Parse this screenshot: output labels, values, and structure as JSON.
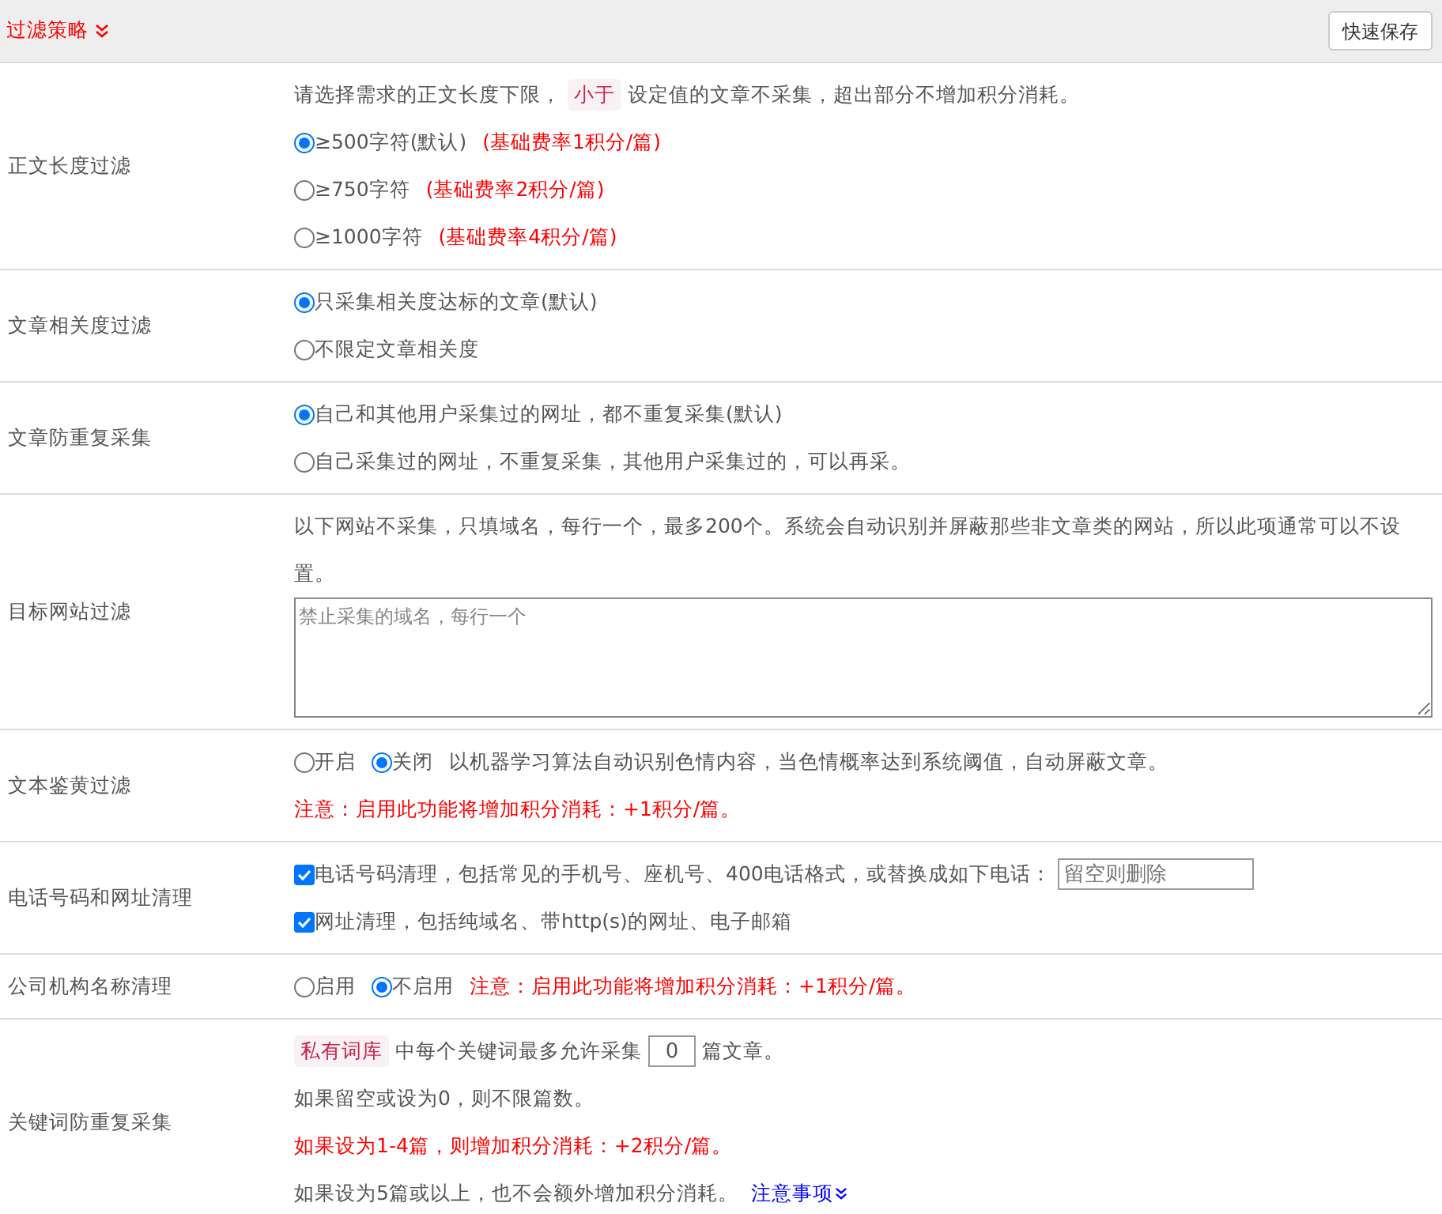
{
  "header": {
    "title": "过滤策略",
    "button": "快速保存"
  },
  "rows": [
    {
      "label": "正文长度过滤",
      "lines": [
        [
          {
            "kind": "text",
            "text": "请选择需求的正文长度下限，"
          },
          {
            "kind": "tag",
            "text": "小于"
          },
          {
            "kind": "text",
            "text": "设定值的文章不采集，超出部分不增加积分消耗。"
          }
        ],
        [
          {
            "kind": "radio",
            "label": "≥500字符(默认)",
            "selected": true
          },
          {
            "kind": "warning",
            "text": "(基础费率1积分/篇)"
          }
        ],
        [
          {
            "kind": "radio",
            "label": "≥750字符",
            "selected": false
          },
          {
            "kind": "warning",
            "text": "(基础费率2积分/篇)"
          }
        ],
        [
          {
            "kind": "radio",
            "label": "≥1000字符",
            "selected": false
          },
          {
            "kind": "warning",
            "text": "(基础费率4积分/篇)"
          }
        ]
      ]
    },
    {
      "label": "文章相关度过滤",
      "lines": [
        [
          {
            "kind": "radio",
            "label": "只采集相关度达标的文章(默认)",
            "selected": true
          }
        ],
        [
          {
            "kind": "radio",
            "label": "不限定文章相关度",
            "selected": false
          }
        ]
      ]
    },
    {
      "label": "文章防重复采集",
      "lines": [
        [
          {
            "kind": "radio",
            "label": "自己和其他用户采集过的网址，都不重复采集(默认)",
            "selected": true
          }
        ],
        [
          {
            "kind": "radio",
            "label": "自己采集过的网址，不重复采集，其他用户采集过的，可以再采。",
            "selected": false
          }
        ]
      ]
    },
    {
      "label": "目标网站过滤",
      "lines": [
        [
          {
            "kind": "text",
            "text": "以下网站不采集，只填域名，每行一个，最多200个。系统会自动识别并屏蔽那些非文章类的网站，所以此项通常可以不设置。"
          }
        ],
        [
          {
            "kind": "textarea",
            "placeholder": "禁止采集的域名，每行一个"
          }
        ]
      ]
    },
    {
      "label": "文本鉴黄过滤",
      "lines": [
        [
          {
            "kind": "radio",
            "label": "开启",
            "selected": false
          },
          {
            "kind": "radio",
            "label": "关闭",
            "selected": true
          },
          {
            "kind": "text",
            "text": "以机器学习算法自动识别色情内容，当色情概率达到系统阈值，自动屏蔽文章。"
          }
        ],
        [
          {
            "kind": "warning",
            "text": "注意：启用此功能将增加积分消耗：+1积分/篇。"
          }
        ]
      ]
    },
    {
      "label": "电话号码和网址清理",
      "lines": [
        [
          {
            "kind": "checkbox",
            "label": "电话号码清理，包括常见的手机号、座机号、400电话格式，或替换成如下电话：",
            "checked": true
          },
          {
            "kind": "input",
            "placeholder": "留空则删除"
          }
        ],
        [
          {
            "kind": "checkbox",
            "label": "网址清理，包括纯域名、带http(s)的网址、电子邮箱",
            "checked": true
          }
        ]
      ]
    },
    {
      "label": "公司机构名称清理",
      "lines": [
        [
          {
            "kind": "radio",
            "label": "启用",
            "selected": false
          },
          {
            "kind": "radio",
            "label": "不启用",
            "selected": true
          },
          {
            "kind": "warning",
            "text": "注意：启用此功能将增加积分消耗：+1积分/篇。"
          }
        ]
      ]
    },
    {
      "label": "关键词防重复采集",
      "lines": [
        [
          {
            "kind": "tag",
            "text": "私有词库"
          },
          {
            "kind": "text",
            "text": "中每个关键词最多允许采集"
          },
          {
            "kind": "number",
            "value": "0"
          },
          {
            "kind": "text",
            "text": "篇文章。"
          }
        ],
        [
          {
            "kind": "text",
            "text": "如果留空或设为0，则不限篇数。"
          }
        ],
        [
          {
            "kind": "warning",
            "text": "如果设为1-4篇，则增加积分消耗：+2积分/篇。"
          }
        ],
        [
          {
            "kind": "text",
            "text": "如果设为5篇或以上，也不会额外增加积分消耗。"
          },
          {
            "kind": "link",
            "text": "注意事项"
          }
        ]
      ]
    }
  ]
}
